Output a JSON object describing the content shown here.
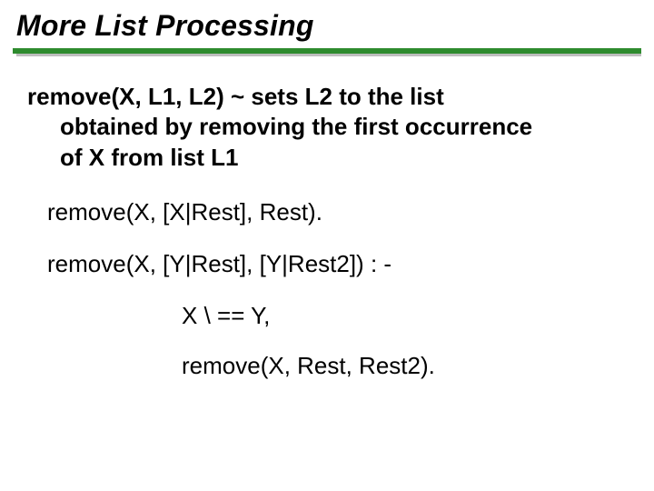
{
  "title": "More List Processing",
  "desc": {
    "line1": "remove(X, L1, L2) ~ sets L2 to the list",
    "line2": "obtained by removing the first occurrence",
    "line3": "of X from list L1"
  },
  "code": {
    "base": "remove(X, [X|Rest], Rest).",
    "rec_head": "remove(X, [Y|Rest], [Y|Rest2]) : -",
    "rec_cond": "X \\ == Y,",
    "rec_call": "remove(X, Rest, Rest2)."
  }
}
